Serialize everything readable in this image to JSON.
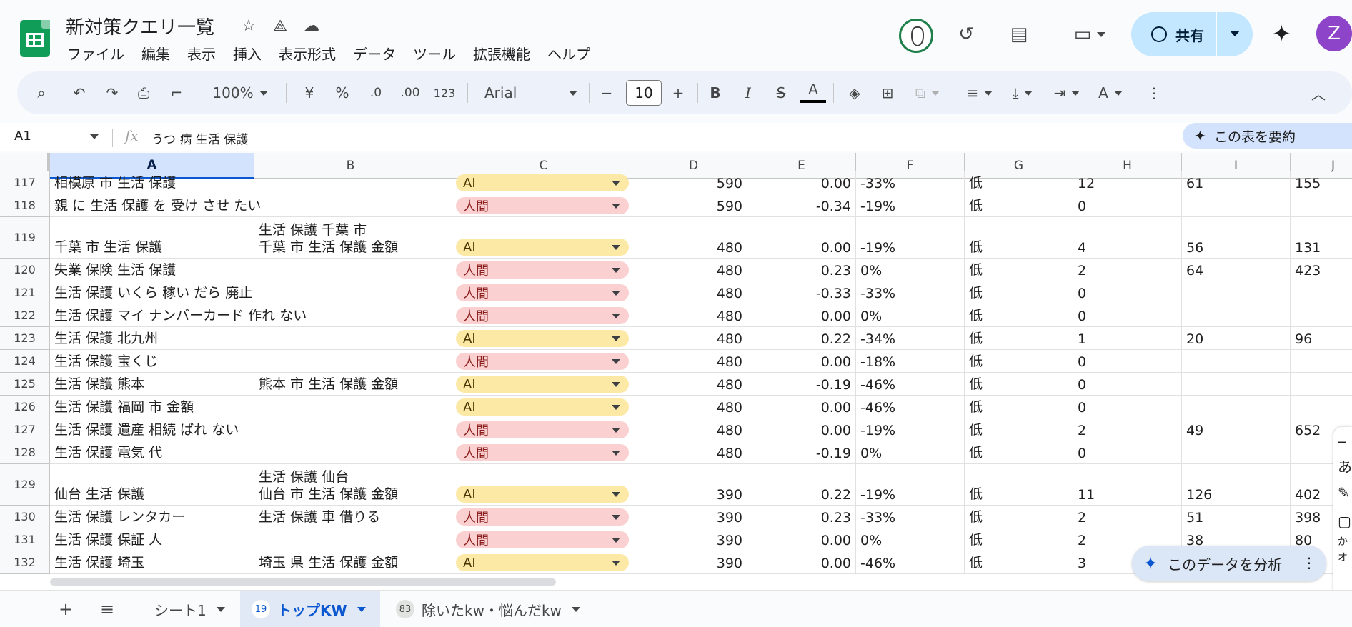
{
  "header": {
    "title": "新対策クエリ一覧",
    "menu": [
      "ファイル",
      "編集",
      "表示",
      "挿入",
      "表示形式",
      "データ",
      "ツール",
      "拡張機能",
      "ヘルプ"
    ],
    "share_label": "共有",
    "user_initial": "Z"
  },
  "toolbar": {
    "zoom": "100%",
    "currency": "¥",
    "percent": "%",
    "dec_decrease": ".0",
    "dec_increase": ".00",
    "format_123": "123",
    "font": "Arial",
    "font_size": "10"
  },
  "formula_bar": {
    "cell_ref": "A1",
    "fx": "fx",
    "value": "うつ 病 生活 保護",
    "summarize_label": "この表を要約"
  },
  "columns": [
    "A",
    "B",
    "C",
    "D",
    "E",
    "F",
    "G",
    "H",
    "I",
    "J"
  ],
  "rows": [
    {
      "num": "117",
      "a": "相模原 市 生活 保護",
      "b": "",
      "c": "AI",
      "d": "590",
      "e": "0.00",
      "f": "-33%",
      "g": "低",
      "h": "12",
      "i": "61",
      "j": "155"
    },
    {
      "num": "118",
      "a": "親 に 生活 保護 を 受け させ たい",
      "b": "",
      "c": "人間",
      "d": "590",
      "e": "-0.34",
      "f": "-19%",
      "g": "低",
      "h": "0",
      "i": "",
      "j": ""
    },
    {
      "num": "119",
      "a": "千葉 市 生活 保護",
      "b": "生活 保護 千葉 市",
      "b2": "千葉 市 生活 保護 金額",
      "c": "AI",
      "d": "480",
      "e": "0.00",
      "f": "-19%",
      "g": "低",
      "h": "4",
      "i": "56",
      "j": "131"
    },
    {
      "num": "120",
      "a": "失業 保険 生活 保護",
      "b": "",
      "c": "人間",
      "d": "480",
      "e": "0.23",
      "f": "0%",
      "g": "低",
      "h": "2",
      "i": "64",
      "j": "423"
    },
    {
      "num": "121",
      "a": "生活 保護 いくら 稼い だら 廃止",
      "b": "",
      "c": "人間",
      "d": "480",
      "e": "-0.33",
      "f": "-33%",
      "g": "低",
      "h": "0",
      "i": "",
      "j": ""
    },
    {
      "num": "122",
      "a": "生活 保護 マイ ナンバーカード 作れ ない",
      "b": "",
      "c": "人間",
      "d": "480",
      "e": "0.00",
      "f": "0%",
      "g": "低",
      "h": "0",
      "i": "",
      "j": ""
    },
    {
      "num": "123",
      "a": "生活 保護 北九州",
      "b": "",
      "c": "AI",
      "d": "480",
      "e": "0.22",
      "f": "-34%",
      "g": "低",
      "h": "1",
      "i": "20",
      "j": "96"
    },
    {
      "num": "124",
      "a": "生活 保護 宝くじ",
      "b": "",
      "c": "人間",
      "d": "480",
      "e": "0.00",
      "f": "-18%",
      "g": "低",
      "h": "0",
      "i": "",
      "j": ""
    },
    {
      "num": "125",
      "a": "生活 保護 熊本",
      "b": "熊本 市 生活 保護 金額",
      "c": "AI",
      "d": "480",
      "e": "-0.19",
      "f": "-46%",
      "g": "低",
      "h": "0",
      "i": "",
      "j": ""
    },
    {
      "num": "126",
      "a": "生活 保護 福岡 市 金額",
      "b": "",
      "c": "AI",
      "d": "480",
      "e": "0.00",
      "f": "-46%",
      "g": "低",
      "h": "0",
      "i": "",
      "j": ""
    },
    {
      "num": "127",
      "a": "生活 保護 遺産 相続 ばれ ない",
      "b": "",
      "c": "人間",
      "d": "480",
      "e": "0.00",
      "f": "-19%",
      "g": "低",
      "h": "2",
      "i": "49",
      "j": "652"
    },
    {
      "num": "128",
      "a": "生活 保護 電気 代",
      "b": "",
      "c": "人間",
      "d": "480",
      "e": "-0.19",
      "f": "0%",
      "g": "低",
      "h": "0",
      "i": "",
      "j": ""
    },
    {
      "num": "129",
      "a": "仙台 生活 保護",
      "b": "生活 保護 仙台",
      "b2": "仙台 市 生活 保護 金額",
      "c": "AI",
      "d": "390",
      "e": "0.22",
      "f": "-19%",
      "g": "低",
      "h": "11",
      "i": "126",
      "j": "402"
    },
    {
      "num": "130",
      "a": "生活 保護 レンタカー",
      "b": "生活 保護 車 借りる",
      "c": "人間",
      "d": "390",
      "e": "0.23",
      "f": "-33%",
      "g": "低",
      "h": "2",
      "i": "51",
      "j": "398"
    },
    {
      "num": "131",
      "a": "生活 保護 保証 人",
      "b": "",
      "c": "人間",
      "d": "390",
      "e": "0.00",
      "f": "0%",
      "g": "低",
      "h": "2",
      "i": "38",
      "j": "80"
    },
    {
      "num": "132",
      "a": "生活 保護 埼玉",
      "b": "埼玉 県 生活 保護 金額",
      "c": "AI",
      "d": "390",
      "e": "0.00",
      "f": "-46%",
      "g": "低",
      "h": "3",
      "i": "",
      "j": ""
    }
  ],
  "analyze_label": "このデータを分析",
  "side_widget": [
    "あ",
    "か",
    "オ"
  ],
  "sheets": [
    {
      "badge": "",
      "name": "シート1",
      "active": false
    },
    {
      "badge": "19",
      "name": "トップKW",
      "active": true
    },
    {
      "badge": "83",
      "name": "除いたkw・悩んだkw",
      "active": false
    }
  ],
  "colors": {
    "accent": "#0b57d0",
    "ai_chip": "#fde9a6",
    "human_chip": "#fbd0d0",
    "share": "#c2e7ff",
    "brand": "#0f9d58"
  }
}
